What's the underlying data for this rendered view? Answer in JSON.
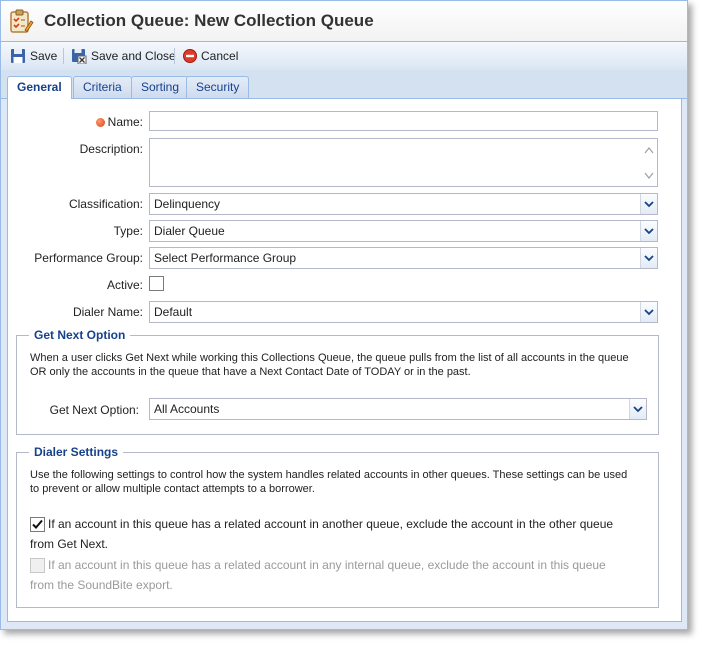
{
  "window": {
    "title": "Collection Queue: New Collection Queue",
    "title_icon": "clipboard-checklist-icon"
  },
  "toolbar": {
    "save_label": "Save",
    "save_close_label": "Save and Close",
    "cancel_label": "Cancel"
  },
  "tabs": [
    {
      "label": "General",
      "active": true
    },
    {
      "label": "Criteria",
      "active": false
    },
    {
      "label": "Sorting",
      "active": false
    },
    {
      "label": "Security",
      "active": false
    }
  ],
  "form": {
    "name": {
      "label": "Name:",
      "value": ""
    },
    "description": {
      "label": "Description:",
      "value": ""
    },
    "classification": {
      "label": "Classification:",
      "value": "Delinquency"
    },
    "type": {
      "label": "Type:",
      "value": "Dialer Queue"
    },
    "performance_group": {
      "label": "Performance Group:",
      "value": "Select Performance Group"
    },
    "active": {
      "label": "Active:",
      "checked": false
    },
    "dialer_name": {
      "label": "Dialer Name:",
      "value": "Default"
    }
  },
  "get_next": {
    "legend": "Get Next Option",
    "description_line1": "When a user clicks Get Next while working this Collections Queue, the queue pulls from the list of all accounts in the queue",
    "description_line2": "OR only the accounts in the queue that have a Next Contact Date of TODAY or in the past.",
    "option_label": "Get Next Option:",
    "option_value": "All Accounts"
  },
  "dialer_settings": {
    "legend": "Dialer Settings",
    "description_line1": "Use the following settings to control how the system handles related accounts in other queues. These settings can be used",
    "description_line2": "to prevent or allow multiple contact attempts to a borrower.",
    "option1_line1": "If an account in this queue has a related account in another queue, exclude the account in the other queue",
    "option1_line2": "from Get Next.",
    "option1_checked": true,
    "option2_line1": "If an account in this queue has a related account in any internal queue, exclude the account in this queue",
    "option2_line2": "from the SoundBite export.",
    "option2_checked": false,
    "option2_disabled": true
  }
}
